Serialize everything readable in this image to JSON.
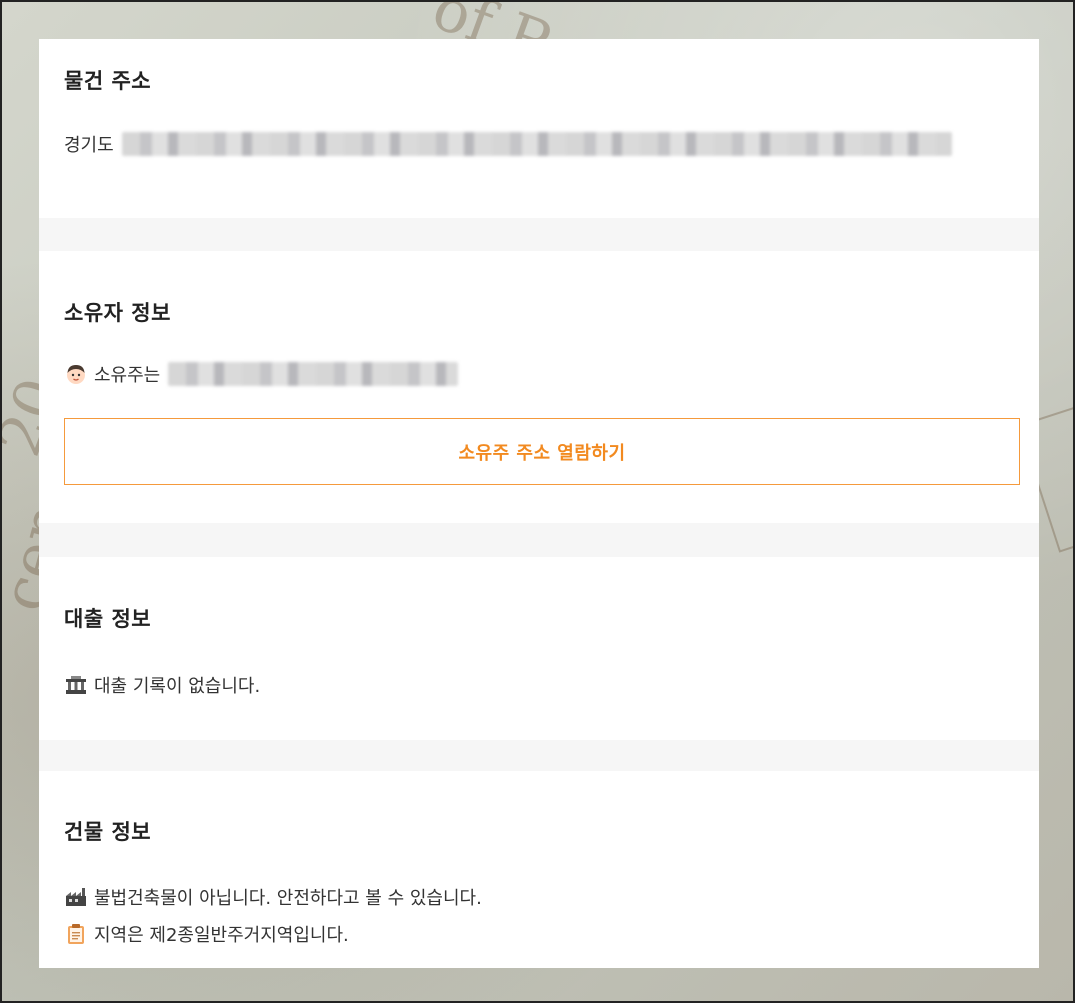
{
  "property_address": {
    "title": "물건 주소",
    "address_prefix": "경기도"
  },
  "owner_info": {
    "title": "소유자 정보",
    "owner_label": "소유주는",
    "view_address_button": "소유주 주소 열람하기"
  },
  "loan_info": {
    "title": "대출 정보",
    "status": "대출 기록이 없습니다."
  },
  "building_info": {
    "title": "건물 정보",
    "legal_status": "불법건축물이 아닙니다. 안전하다고 볼 수 있습니다.",
    "zoning": "지역은 제2종일반주거지역입니다."
  },
  "colors": {
    "accent": "#f28a20",
    "section_gap": "#f6f6f6"
  },
  "icons": [
    "person-face-icon",
    "bank-icon",
    "factory-icon",
    "clipboard-icon"
  ]
}
